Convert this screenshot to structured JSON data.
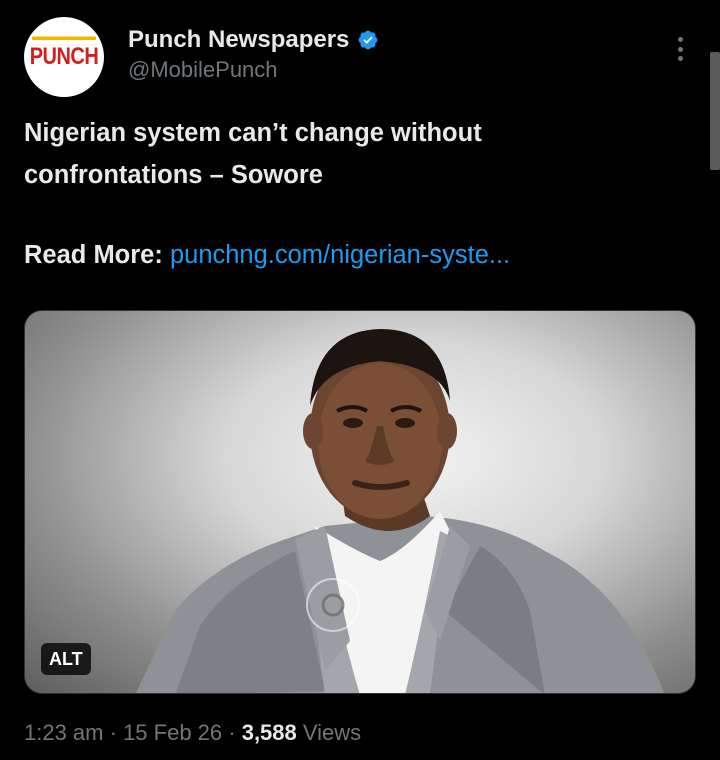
{
  "account": {
    "display_name": "Punch Newspapers",
    "handle": "@MobilePunch",
    "avatar_text": "PUNCH",
    "verified": true
  },
  "tweet": {
    "text_line1": "Nigerian system can’t change without",
    "text_line2": "confrontations – Sowore",
    "read_more_label": "Read More:",
    "link_text": "punchng.com/nigerian-syste..."
  },
  "media": {
    "alt_badge": "ALT"
  },
  "meta": {
    "time": "1:23 am",
    "separator1": " · ",
    "date": "15 Feb 26",
    "separator2": " · ",
    "views_count": "3,588",
    "views_label": " Views"
  },
  "colors": {
    "background": "#000000",
    "text": "#e7e9ea",
    "secondary": "#71767b",
    "link": "#1d9bf0",
    "verified": "#1d9bf0",
    "brand_red": "#d1201f"
  },
  "icons": {
    "verified": "verified-badge-icon",
    "more": "more-options-icon"
  }
}
